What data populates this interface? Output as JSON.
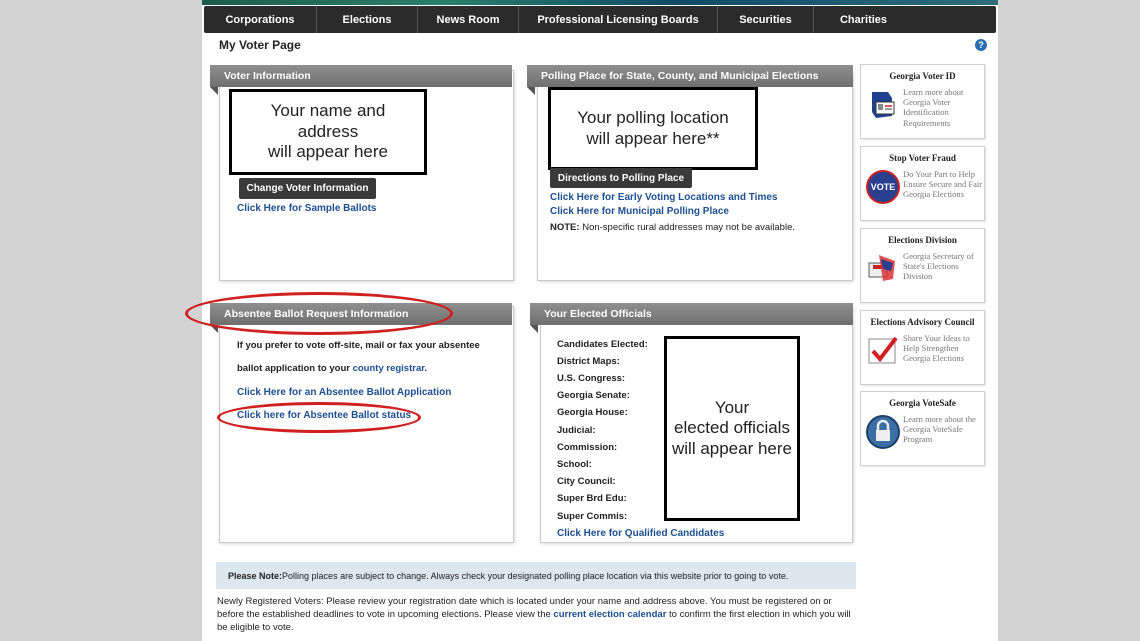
{
  "nav": [
    "Corporations",
    "Elections",
    "News Room",
    "Professional Licensing Boards",
    "Securities",
    "Charities"
  ],
  "page_title": "My Voter Page",
  "help": "?",
  "voter_info": {
    "header": "Voter Information",
    "placeholder_line1": "Your name and",
    "placeholder_line2": "address",
    "placeholder_line3": "will appear here",
    "change_button": "Change Voter Information",
    "sample_link": "Click Here for Sample Ballots"
  },
  "polling": {
    "header": "Polling Place for State, County, and Municipal Elections",
    "placeholder_line1": "Your polling location",
    "placeholder_line2": "will appear here**",
    "directions_button": "Directions to Polling Place",
    "early_link": "Click Here for Early Voting Locations and Times",
    "municipal_link": "Click Here for Municipal Polling Place",
    "note_label": "NOTE:",
    "note_text": " Non-specific rural addresses may not be available."
  },
  "absentee": {
    "header": "Absentee Ballot Request Information",
    "line1": "If you prefer to vote off-site, mail or fax your absentee",
    "line2_prefix": "ballot application to your ",
    "line2_link": "county registrar",
    "line2_suffix": ".",
    "application_link": "Click Here for an Absentee Ballot Application",
    "status_link": "Click here for Absentee Ballot status"
  },
  "officials": {
    "header": "Your Elected Officials",
    "rows": [
      "Candidates Elected:",
      "District Maps:",
      "U.S. Congress:",
      "Georgia Senate:",
      "Georgia House:",
      "Judicial:",
      "Commission:",
      "School:",
      "City Council:",
      "Super Brd Edu:",
      "Super Commis:"
    ],
    "placeholder_line1": "Your",
    "placeholder_line2": "elected officials",
    "placeholder_line3": "will appear here",
    "qualified_link": "Click Here for Qualified Candidates"
  },
  "sidebar": [
    {
      "title": "Georgia Voter ID",
      "desc": "Learn more about Georgia Voter Identification Requirements",
      "icon": "voter-id-icon"
    },
    {
      "title": "Stop Voter Fraud",
      "desc": "Do Your Part to Help Ensure Secure and Fair Georgia Elections",
      "icon": "vote-badge-icon",
      "icon_text": "VOTE"
    },
    {
      "title": "Elections Division",
      "desc": "Georgia Secretary of State's Elections Division",
      "icon": "elections-division-icon"
    },
    {
      "title": "Elections Advisory Council",
      "desc": "Share Your Ideas to Help Strengthen Georgia Elections",
      "icon": "checkmark-icon"
    },
    {
      "title": "Georgia VoteSafe",
      "desc": "Learn more about the Georgia VoteSafe Program",
      "icon": "lock-icon"
    }
  ],
  "notice": {
    "label": "Please Note:",
    "text": " Polling places are subject to change. Always check your designated polling place location via this website prior to going to vote."
  },
  "registration": {
    "text1": "Newly Registered Voters:  Please review your registration date which is located under your name and address above.  You must be registered on or before the established deadlines to vote in upcoming elections.  Please view the ",
    "link": "current election calendar",
    "text2": " to confirm the first election in which you will be eligible to vote."
  },
  "colors": {
    "link": "#1d4f91",
    "annotation_red": "#d02020",
    "header_gray": "#7a7a7a"
  }
}
